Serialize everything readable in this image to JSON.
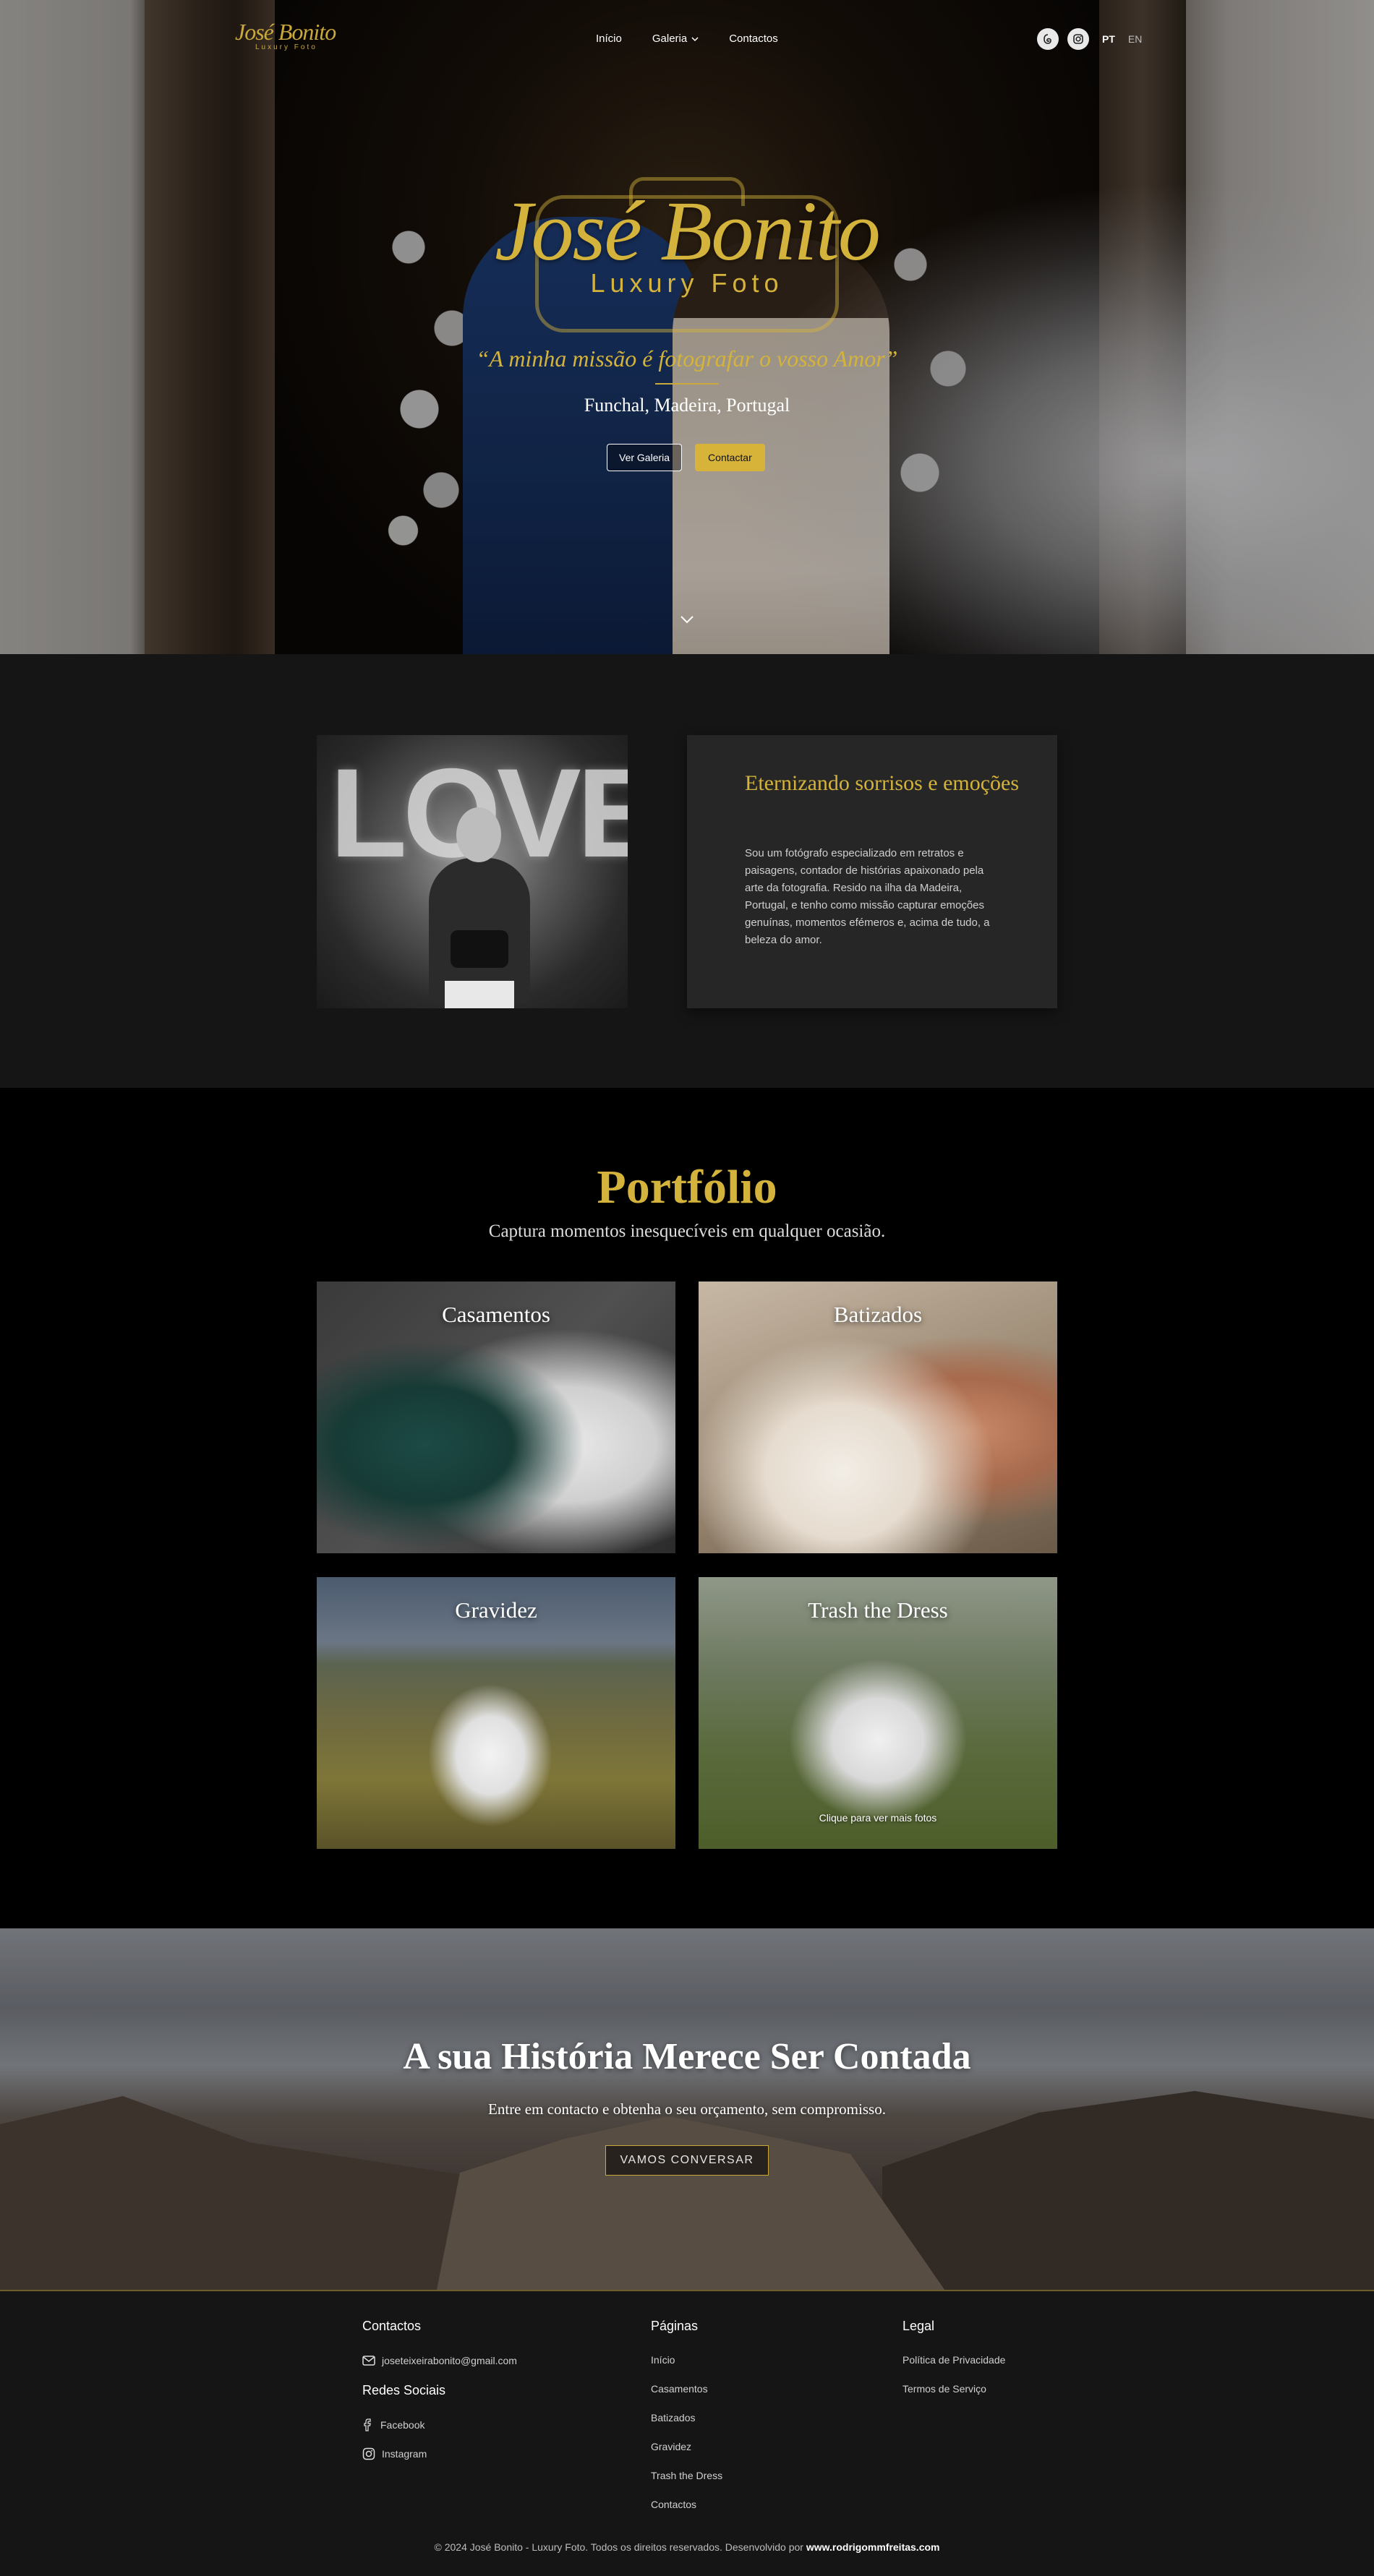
{
  "nav": {
    "logo": {
      "name": "José Bonito",
      "sub": "Luxury Foto"
    },
    "links": [
      {
        "label": "Início"
      },
      {
        "label": "Galeria"
      },
      {
        "label": "Contactos"
      }
    ],
    "languages": [
      "PT",
      "EN"
    ],
    "active_language": "PT"
  },
  "hero": {
    "logo_name": "José Bonito",
    "logo_sub": "Luxury Foto",
    "tagline": "“A minha missão é fotografar o vosso Amor”",
    "location": "Funchal, Madeira, Portugal",
    "btn_gallery": "Ver Galeria",
    "btn_contact": "Contactar"
  },
  "about": {
    "photo_text": "LOVE",
    "title": "Eternizando sorrisos e emoções",
    "body": "Sou um fotógrafo especializado em retratos e paisagens, contador de histórias apaixonado pela arte da fotografia. Resido na ilha da Madeira, Portugal, e tenho como missão capturar emoções genuínas, momentos efémeros e, acima de tudo, a beleza do amor."
  },
  "portfolio": {
    "title": "Portfólio",
    "subtitle": "Captura momentos inesquecíveis em qualquer ocasião.",
    "categories": [
      {
        "label": "Casamentos"
      },
      {
        "label": "Batizados"
      },
      {
        "label": "Gravidez"
      },
      {
        "label": "Trash the Dress",
        "hint": "Clique para ver mais fotos"
      }
    ]
  },
  "cta": {
    "title": "A sua História Merece Ser Contada",
    "subtitle": "Entre em contacto e obtenha o seu orçamento, sem compromisso.",
    "button": "VAMOS CONVERSAR"
  },
  "footer": {
    "contacts_heading": "Contactos",
    "email": "joseteixeirabonito@gmail.com",
    "social_heading": "Redes Sociais",
    "social": [
      "Facebook",
      "Instagram"
    ],
    "pages_heading": "Páginas",
    "pages": [
      "Início",
      "Casamentos",
      "Batizados",
      "Gravidez",
      "Trash the Dress",
      "Contactos"
    ],
    "legal_heading": "Legal",
    "legal": [
      "Política de Privacidade",
      "Termos de Serviço"
    ],
    "copyright": "© 2024 José Bonito - Luxury Foto. Todos os direitos reservados. Desenvolvido por ",
    "developer": "www.rodrigommfreitas.com"
  },
  "colors": {
    "gold": "#d4b33c",
    "dark": "#151515",
    "card": "#262626",
    "black": "#000000"
  },
  "icons": [
    "threads-icon",
    "instagram-icon",
    "chevron-down-icon",
    "mail-icon",
    "facebook-icon"
  ]
}
